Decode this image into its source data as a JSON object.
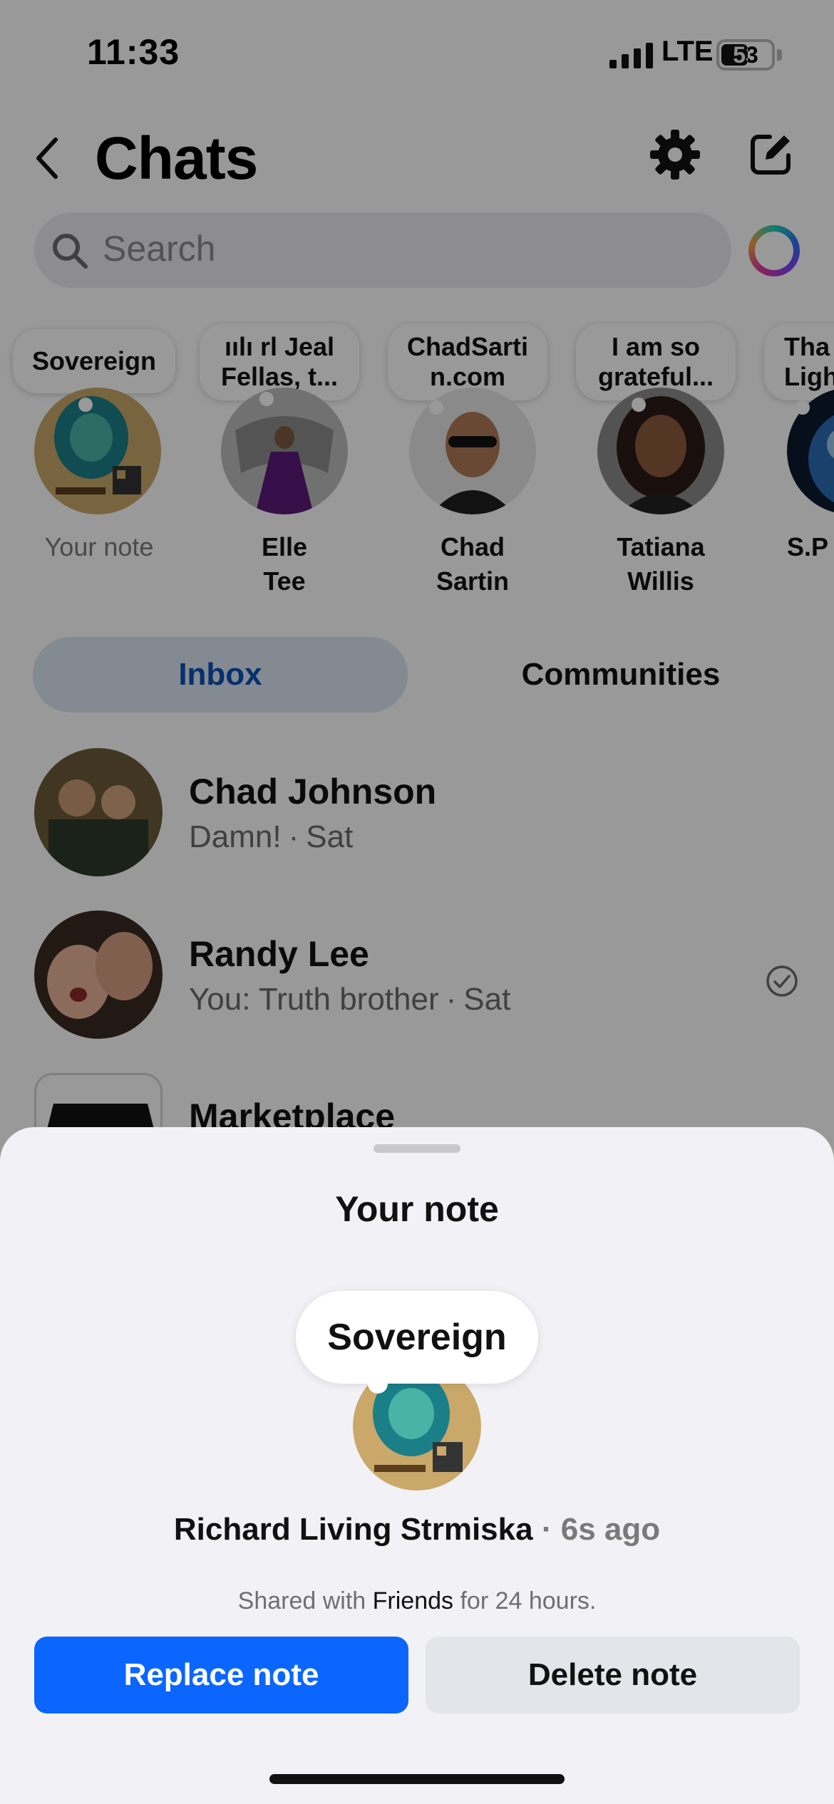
{
  "status_bar": {
    "time": "11:33",
    "network": "LTE",
    "battery": "53",
    "battery_level": 0.53
  },
  "header": {
    "title": "Chats",
    "icons": [
      "back-icon",
      "gear-icon",
      "compose-icon"
    ]
  },
  "search": {
    "placeholder": "Search",
    "icon": "search-icon"
  },
  "notes": [
    {
      "note": "Sovereign",
      "name": "Your note"
    },
    {
      "note_line1": "ıılı rl  Jeal",
      "note_line2": "Fellas, t...",
      "name_line1": "Elle",
      "name_line2": "Tee"
    },
    {
      "note_line1": "ChadSarti",
      "note_line2": "n.com",
      "name_line1": "Chad",
      "name_line2": "Sartin"
    },
    {
      "note_line1": "I am so",
      "note_line2": "grateful...",
      "name_line1": "Tatiana",
      "name_line2": "Willis"
    },
    {
      "note_line1": "Tha",
      "note_line2": "Ligh",
      "name_line1": "S.P"
    }
  ],
  "tabs": {
    "inbox": "Inbox",
    "communities": "Communities",
    "active": "inbox"
  },
  "chats": [
    {
      "name": "Chad Johnson",
      "preview": "Damn!",
      "time": "Sat"
    },
    {
      "name": "Randy Lee",
      "preview": "You: Truth brother",
      "time": "Sat",
      "status_icon": "read-check-icon"
    },
    {
      "name": "Marketplace"
    }
  ],
  "sheet": {
    "title": "Your note",
    "note": "Sovereign",
    "owner": "Richard Living Strmiska",
    "time_ago": "6s ago",
    "shared_prefix": "Shared with",
    "audience": "Friends",
    "shared_suffix": "for 24 hours.",
    "replace_label": "Replace note",
    "delete_label": "Delete note"
  },
  "colors": {
    "accent": "#0a66ff",
    "inbox_tab_text": "#0a4fb8",
    "sheet_bg": "#f2f2f6"
  }
}
